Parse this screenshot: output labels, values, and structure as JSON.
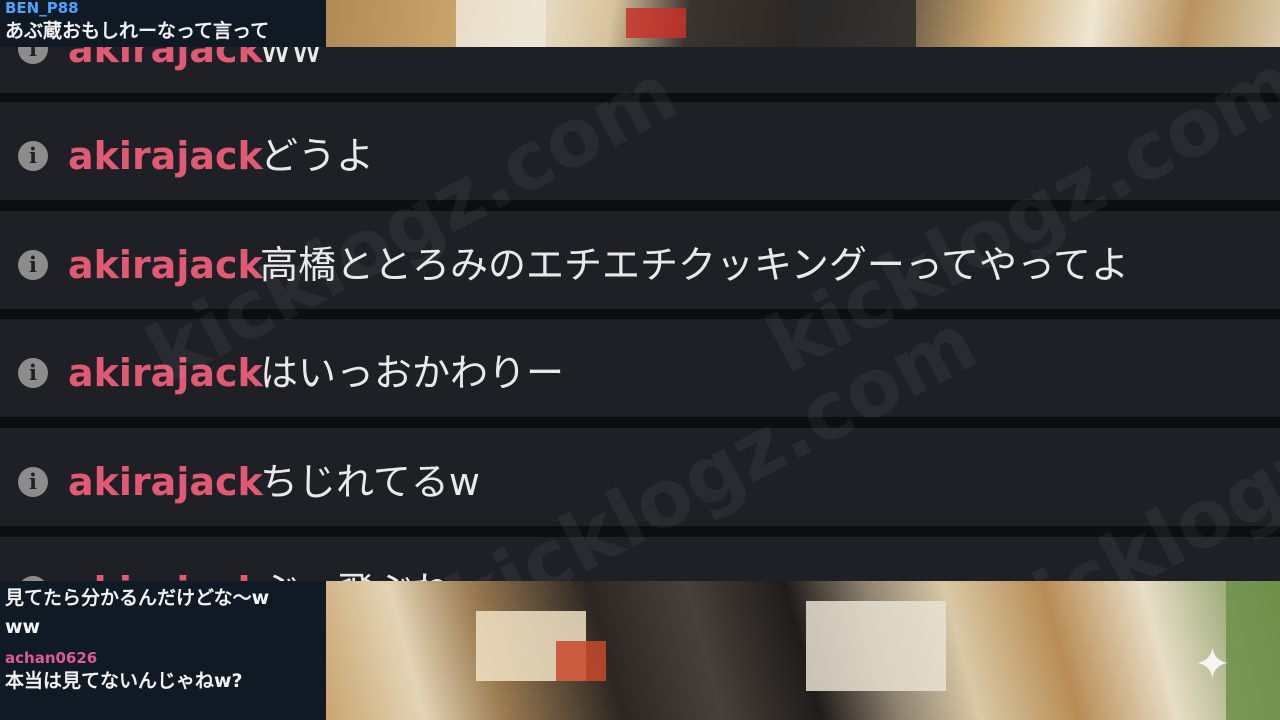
{
  "side_chat_top": {
    "messages": [
      {
        "user": "BEN_P88",
        "user_color": "#4aa3ff",
        "text": "あぶ蔵おもしれーなって言って"
      }
    ]
  },
  "chat_log": {
    "username_color": "#e05a73",
    "info_icon": "info-icon",
    "rows": [
      {
        "user": "akirajack",
        "text": "ww"
      },
      {
        "user": "akirajack",
        "text": "どうよ"
      },
      {
        "user": "akirajack",
        "text": "高橋ととろみのエチエチクッキングーってやってよ"
      },
      {
        "user": "akirajack",
        "text": "はいっおかわりー"
      },
      {
        "user": "akirajack",
        "text": "ちじれてるw"
      },
      {
        "user": "akirajack",
        "text": "ぶっ飛ぶね"
      }
    ],
    "watermark": "kicklogz.com"
  },
  "side_chat_bottom": {
    "messages": [
      {
        "user": "",
        "user_color": "#4aa3ff",
        "text": "見てたら分かるんだけどな〜w"
      },
      {
        "user": "",
        "user_color": "#4aa3ff",
        "text": "ww"
      },
      {
        "user": "achan0626",
        "user_color": "#e05a9a",
        "text": "本当は見てないんじゃねw?"
      }
    ]
  },
  "overlay_icon": "sparkle-icon"
}
